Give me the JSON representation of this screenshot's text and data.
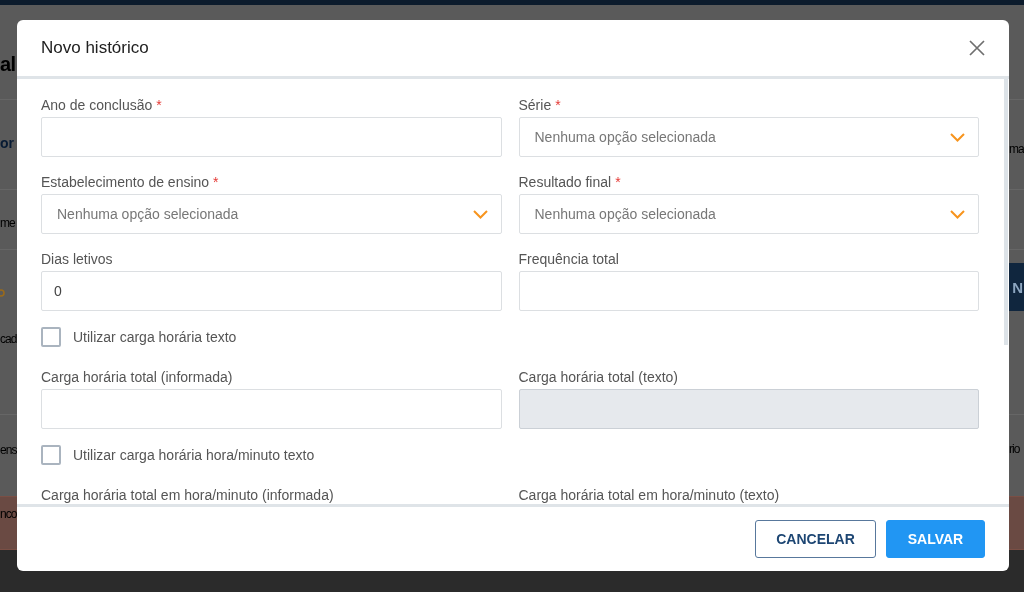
{
  "background_page": {
    "heading": "al",
    "link": "or",
    "text_1": "me",
    "text_2": "cad",
    "text_3": "ens",
    "right_text_1": "ma",
    "button": "N",
    "right_text_2": "rio",
    "banner": "nco"
  },
  "dialog": {
    "title": "Novo histórico",
    "fields": [
      {
        "kind": "text",
        "label": "Ano de conclusão",
        "required_mark": "*",
        "disabled": false
      },
      {
        "kind": "select",
        "label": "Série",
        "required_mark": "*",
        "placeholder": "Nenhuma opção selecionada",
        "disabled": false
      },
      {
        "kind": "select",
        "label": "Estabelecimento de ensino",
        "required_mark": "*",
        "placeholder": "Nenhuma opção selecionada",
        "disabled": false
      },
      {
        "kind": "select",
        "label": "Resultado final",
        "required_mark": "*",
        "placeholder": "Nenhuma opção selecionada",
        "disabled": false
      },
      {
        "kind": "text",
        "label": "Dias letivos",
        "value": "0",
        "disabled": false
      },
      {
        "kind": "text",
        "label": "Frequência total",
        "disabled": false
      },
      {
        "kind": "checkbox",
        "label": "Utilizar carga horária texto",
        "checked": false
      },
      {
        "kind": "text",
        "label": "Carga horária total (informada)",
        "disabled": false
      },
      {
        "kind": "text",
        "label": "Carga horária total (texto)",
        "disabled": true
      },
      {
        "kind": "checkbox",
        "label": "Utilizar carga horária hora/minuto texto",
        "checked": false
      },
      {
        "kind": "label",
        "label": "Carga horária total em hora/minuto (informada)"
      },
      {
        "kind": "label",
        "label": "Carga horária total em hora/minuto (texto)"
      }
    ],
    "buttons": [
      {
        "label": "CANCELAR",
        "kind": "secondary"
      },
      {
        "label": "SALVAR",
        "kind": "primary"
      }
    ]
  }
}
